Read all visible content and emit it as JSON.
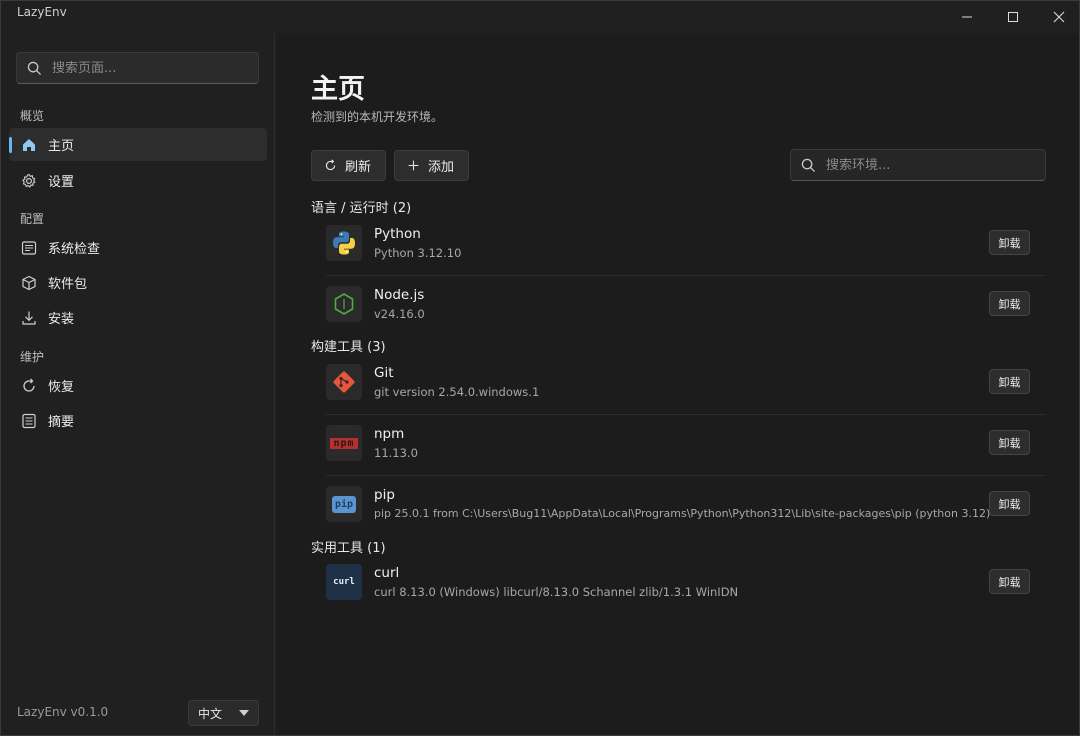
{
  "window": {
    "title": "LazyEnv"
  },
  "sidebar": {
    "search_placeholder": "搜索页面...",
    "sections": [
      {
        "label": "概览"
      },
      {
        "label": "配置"
      },
      {
        "label": "维护"
      }
    ],
    "items": [
      {
        "label": "主页",
        "icon": "home-icon",
        "active": true
      },
      {
        "label": "设置",
        "icon": "gear-icon"
      },
      {
        "label": "系统检查",
        "icon": "list-icon"
      },
      {
        "label": "软件包",
        "icon": "box-icon"
      },
      {
        "label": "安装",
        "icon": "download-icon"
      },
      {
        "label": "恢复",
        "icon": "restore-icon"
      },
      {
        "label": "摘要",
        "icon": "summary-icon"
      }
    ],
    "version": "LazyEnv v0.1.0",
    "language": "中文"
  },
  "main": {
    "title": "主页",
    "subtitle": "检测到的本机开发环境。",
    "refresh_label": "刷新",
    "add_label": "添加",
    "search_placeholder": "搜索环境...",
    "uninstall_label": "卸载",
    "groups": [
      {
        "title": "语言 / 运行时 (2)",
        "items": [
          {
            "name": "Python",
            "version": "Python 3.12.10",
            "icon": "python-icon"
          },
          {
            "name": "Node.js",
            "version": "v24.16.0",
            "icon": "nodejs-icon"
          }
        ]
      },
      {
        "title": "构建工具 (3)",
        "items": [
          {
            "name": "Git",
            "version": "git version 2.54.0.windows.1",
            "icon": "git-icon"
          },
          {
            "name": "npm",
            "version": "11.13.0",
            "icon": "npm-icon",
            "icon_text": "npm"
          },
          {
            "name": "pip",
            "version": "pip 25.0.1 from C:\\Users\\Bug11\\AppData\\Local\\Programs\\Python\\Python312\\Lib\\site-packages\\pip (python 3.12)",
            "icon": "pip-icon",
            "icon_text": "pip"
          }
        ]
      },
      {
        "title": "实用工具 (1)",
        "items": [
          {
            "name": "curl",
            "version": "curl 8.13.0 (Windows) libcurl/8.13.0 Schannel zlib/1.3.1 WinIDN",
            "icon": "curl-icon",
            "icon_text": "curl"
          }
        ]
      }
    ]
  },
  "colors": {
    "accent": "#60b8f0",
    "background": "#202020",
    "panel": "#1c1c1c"
  }
}
